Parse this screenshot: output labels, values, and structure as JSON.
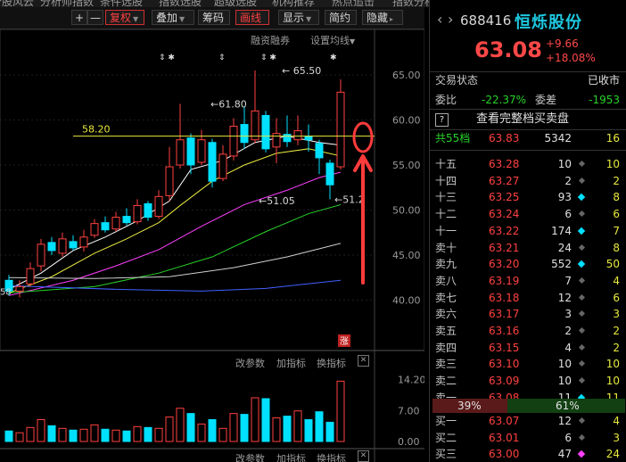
{
  "top_menu": [
    "个股风云",
    "分析师指数",
    "条件选股",
    "指数选股",
    "超级选股",
    "机构推荐",
    "热点追击",
    "指数分析",
    "机构推荐",
    "指数"
  ],
  "toolbar": {
    "plus": "+",
    "minus": "—",
    "fuquan": "复权",
    "diejia": "叠加",
    "chouma": "筹码",
    "huaxian": "画线",
    "xianshi": "显示",
    "jianyue": "简约",
    "yincang": "隐藏"
  },
  "chart_header": {
    "rongzi": "融资融券",
    "shezhi": "设置均线"
  },
  "price_axis": [
    "65.00",
    "60.00",
    "55.00",
    "50.00",
    "45.00",
    "40.00"
  ],
  "vol_axis": [
    "14.20",
    "7.00",
    "0.00"
  ],
  "sub_toolbar": {
    "params": "改参数",
    "add": "加指标",
    "change": "换指标",
    "close": "✕"
  },
  "annotations": {
    "high": "65.50",
    "mid_high": "61.80",
    "low1": "51.05",
    "low2": "51.2",
    "hline": "58.20",
    "left_low": "58",
    "zhang": "涨"
  },
  "stock": {
    "code": "688416",
    "name": "恒烁股份",
    "price": "63.08",
    "change": "+9.66",
    "pct": "+18.08%"
  },
  "status": {
    "label": "交易状态",
    "value": "已收市"
  },
  "weibi": {
    "label": "委比",
    "value": "-22.37%",
    "cha_label": "委差",
    "cha_value": "-1953"
  },
  "depth_link": "查看完整档买卖盘",
  "total": {
    "label": "共55档",
    "price": "63.83",
    "volume": "5342",
    "count": "16"
  },
  "asks": [
    {
      "label": "十五",
      "price": "63.28",
      "vol": "10",
      "dot": "grey",
      "cnt": "10"
    },
    {
      "label": "十四",
      "price": "63.27",
      "vol": "2",
      "dot": "grey",
      "cnt": "2"
    },
    {
      "label": "十三",
      "price": "63.25",
      "vol": "93",
      "dot": "cyan",
      "cnt": "8"
    },
    {
      "label": "十二",
      "price": "63.24",
      "vol": "6",
      "dot": "grey",
      "cnt": "6"
    },
    {
      "label": "十一",
      "price": "63.22",
      "vol": "174",
      "dot": "cyan",
      "cnt": "7"
    },
    {
      "label": "卖十",
      "price": "63.21",
      "vol": "24",
      "dot": "grey",
      "cnt": "8"
    },
    {
      "label": "卖九",
      "price": "63.20",
      "vol": "552",
      "dot": "cyan",
      "cnt": "50"
    },
    {
      "label": "卖八",
      "price": "63.19",
      "vol": "7",
      "dot": "grey",
      "cnt": "4"
    },
    {
      "label": "卖七",
      "price": "63.18",
      "vol": "12",
      "dot": "grey",
      "cnt": "6"
    },
    {
      "label": "卖六",
      "price": "63.17",
      "vol": "3",
      "dot": "grey",
      "cnt": "3"
    },
    {
      "label": "卖五",
      "price": "63.16",
      "vol": "2",
      "dot": "grey",
      "cnt": "2"
    },
    {
      "label": "卖四",
      "price": "63.15",
      "vol": "4",
      "dot": "grey",
      "cnt": "2"
    },
    {
      "label": "卖三",
      "price": "63.10",
      "vol": "10",
      "dot": "grey",
      "cnt": "10"
    },
    {
      "label": "卖二",
      "price": "63.09",
      "vol": "10",
      "dot": "grey",
      "cnt": "10"
    },
    {
      "label": "卖一",
      "price": "63.08",
      "vol": "11",
      "dot": "cyan",
      "cnt": "11"
    }
  ],
  "ratio": {
    "left": "39%",
    "right": "61%"
  },
  "bids": [
    {
      "label": "买一",
      "price": "63.07",
      "vol": "12",
      "dot": "grey",
      "cnt": "4"
    },
    {
      "label": "买二",
      "price": "63.01",
      "vol": "6",
      "dot": "grey",
      "cnt": "3"
    },
    {
      "label": "买三",
      "price": "63.00",
      "vol": "47",
      "dot": "mag",
      "cnt": "24"
    }
  ],
  "colors": {
    "up": "#ff4040",
    "down": "#00e0ff",
    "ma5": "#ffffff",
    "ma10": "#e8e840",
    "ma20": "#ff40ff",
    "ma30": "#28d228",
    "ma60": "#d0d0d0",
    "ma120": "#4060ff"
  }
}
